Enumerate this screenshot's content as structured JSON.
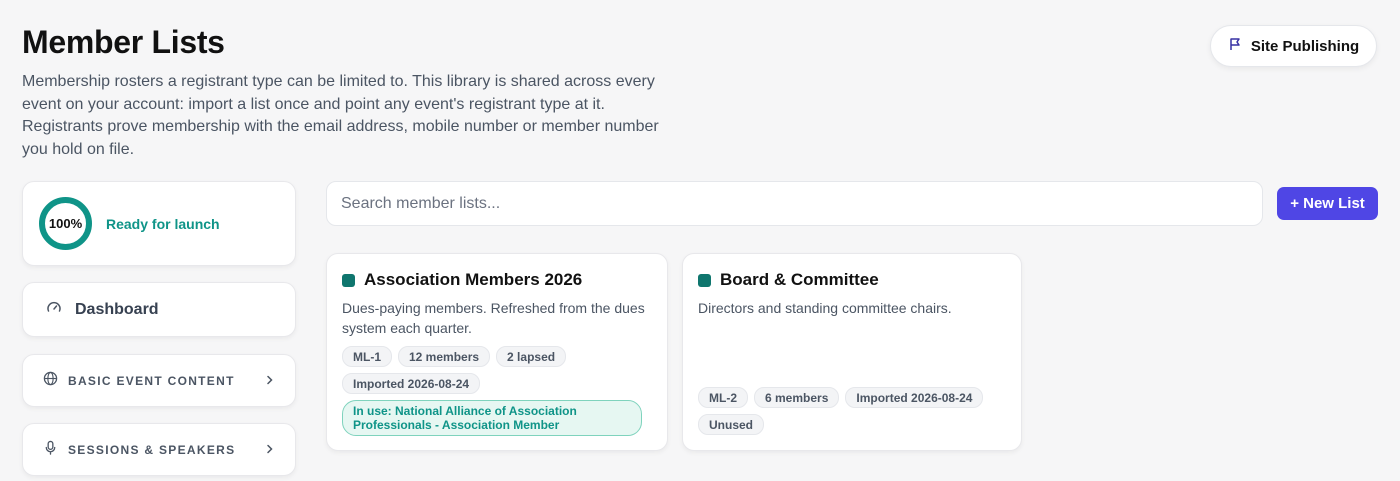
{
  "header": {
    "title": "Member Lists",
    "description": "Membership rosters a registrant type can be limited to. This library is shared across every event on your account: import a list once and point any event's registrant type at it. Registrants prove membership with the email address, mobile number or member number you hold on file.",
    "site_publishing_label": "Site Publishing"
  },
  "sidebar": {
    "progress_value": "100%",
    "progress_fraction": 1.0,
    "progress_label": "Ready for launch",
    "dashboard_label": "Dashboard",
    "sections": [
      {
        "label": "BASIC EVENT CONTENT",
        "icon": "globe-icon"
      },
      {
        "label": "SESSIONS & SPEAKERS",
        "icon": "microphone-icon"
      }
    ]
  },
  "search": {
    "placeholder": "Search member lists..."
  },
  "new_list_label": "+ New List",
  "lists": [
    {
      "name": "Association Members 2026",
      "description": "Dues-paying members. Refreshed from the dues system each quarter.",
      "chips": [
        "ML-1",
        "12 members",
        "2 lapsed",
        "Imported 2026-08-24"
      ],
      "in_use": "In use: National Alliance of Association Professionals - Association Member"
    },
    {
      "name": "Board & Committee",
      "description": "Directors and standing committee chairs.",
      "chips": [
        "ML-2",
        "6 members",
        "Imported 2026-08-24",
        "Unused"
      ]
    }
  ],
  "colors": {
    "accent": "#4f46e5",
    "teal": "#0f9488",
    "list_dot": "#0f766e"
  }
}
